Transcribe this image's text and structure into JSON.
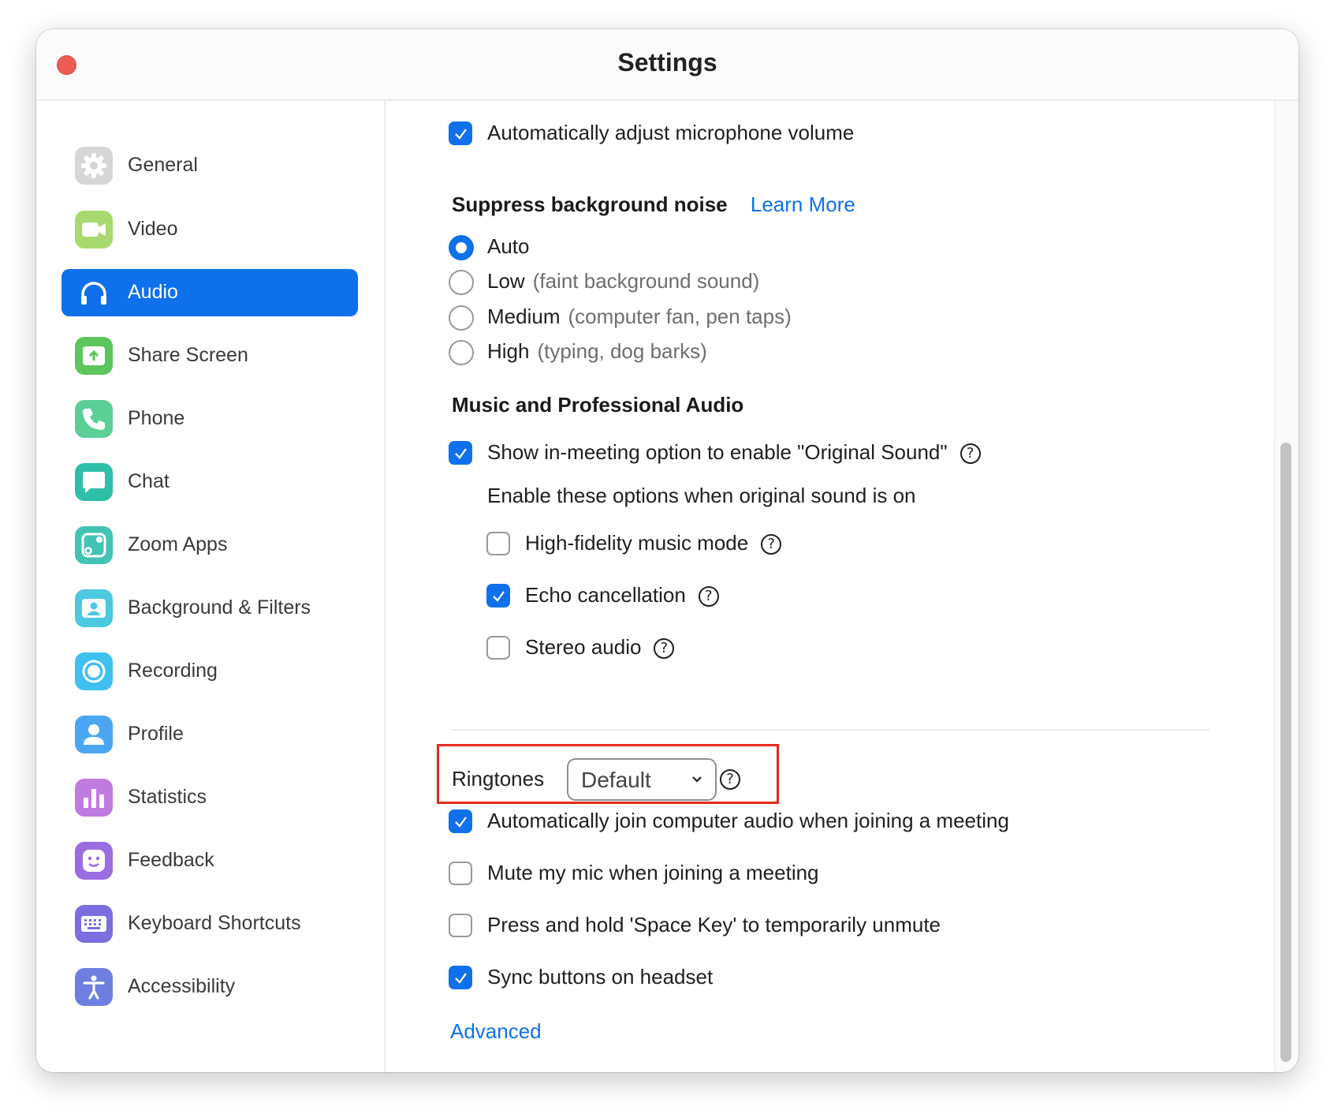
{
  "window": {
    "title": "Settings"
  },
  "sidebar": {
    "items": [
      {
        "label": "General",
        "icon": "gear-icon",
        "color": "#d4d4d4",
        "active": false
      },
      {
        "label": "Video",
        "icon": "video-camera-icon",
        "color": "#a8d96e",
        "active": false
      },
      {
        "label": "Audio",
        "icon": "headphones-icon",
        "color": "#0e71eb",
        "active": true
      },
      {
        "label": "Share Screen",
        "icon": "share-screen-icon",
        "color": "#5cc55c",
        "active": false
      },
      {
        "label": "Phone",
        "icon": "phone-icon",
        "color": "#5ccf96",
        "active": false
      },
      {
        "label": "Chat",
        "icon": "chat-bubble-icon",
        "color": "#2fbfa9",
        "active": false
      },
      {
        "label": "Zoom Apps",
        "icon": "zoom-apps-icon",
        "color": "#41c4b4",
        "active": false
      },
      {
        "label": "Background & Filters",
        "icon": "background-person-icon",
        "color": "#4cc9e0",
        "active": false
      },
      {
        "label": "Recording",
        "icon": "record-icon",
        "color": "#3ec0f0",
        "active": false
      },
      {
        "label": "Profile",
        "icon": "profile-icon",
        "color": "#4aa6f2",
        "active": false
      },
      {
        "label": "Statistics",
        "icon": "statistics-bars-icon",
        "color": "#c07be0",
        "active": false
      },
      {
        "label": "Feedback",
        "icon": "smiley-face-icon",
        "color": "#9a6ee0",
        "active": false
      },
      {
        "label": "Keyboard Shortcuts",
        "icon": "keyboard-icon",
        "color": "#7a6ee0",
        "active": false
      },
      {
        "label": "Accessibility",
        "icon": "accessibility-person-icon",
        "color": "#6f7fe0",
        "active": false
      }
    ]
  },
  "audio": {
    "auto_adjust_mic": {
      "label": "Automatically adjust microphone volume",
      "checked": true
    },
    "suppress_noise": {
      "heading": "Suppress background noise",
      "learn_more": "Learn More",
      "options": [
        {
          "label": "Auto",
          "hint": "",
          "selected": true
        },
        {
          "label": "Low",
          "hint": "(faint background sound)",
          "selected": false
        },
        {
          "label": "Medium",
          "hint": "(computer fan, pen taps)",
          "selected": false
        },
        {
          "label": "High",
          "hint": "(typing, dog barks)",
          "selected": false
        }
      ]
    },
    "music": {
      "heading": "Music and Professional Audio",
      "original_sound": {
        "label": "Show in-meeting option to enable \"Original Sound\"",
        "checked": true
      },
      "sub_heading": "Enable these options when original sound is on",
      "sub_options": [
        {
          "label": "High-fidelity music mode",
          "checked": false
        },
        {
          "label": "Echo cancellation",
          "checked": true
        },
        {
          "label": "Stereo audio",
          "checked": false
        }
      ]
    },
    "ringtones": {
      "label": "Ringtones",
      "value": "Default"
    },
    "options": [
      {
        "label": "Automatically join computer audio when joining a meeting",
        "checked": true
      },
      {
        "label": "Mute my mic when joining a meeting",
        "checked": false
      },
      {
        "label": "Press and hold 'Space Key' to temporarily unmute",
        "checked": false
      },
      {
        "label": "Sync buttons on headset",
        "checked": true
      }
    ],
    "advanced_link": "Advanced",
    "help_glyph": "?"
  },
  "colors": {
    "accent": "#0e71eb",
    "highlight_box": "#e22b1d",
    "close_button": "#ee5b53"
  }
}
